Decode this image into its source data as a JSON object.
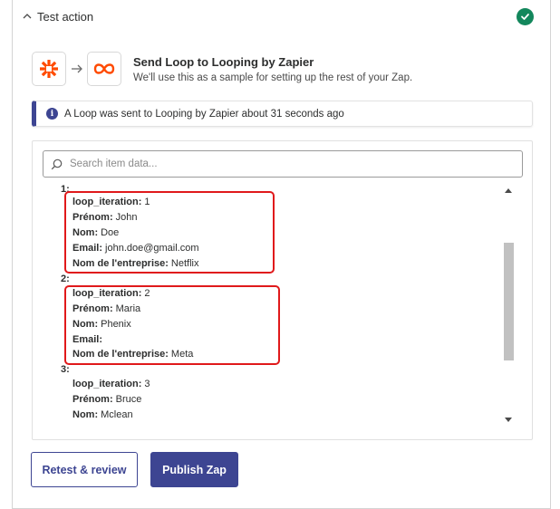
{
  "step": {
    "title": "Test action",
    "status": "success"
  },
  "action": {
    "title": "Send Loop to Looping by Zapier",
    "subtitle": "We'll use this as a sample for setting up the rest of your Zap.",
    "trigger_app_icon": "zapier-asterisk-icon",
    "action_app_icon": "looping-infinity-icon"
  },
  "banner": {
    "icon": "info-icon",
    "icon_glyph": "i",
    "text": "A Loop was sent to Looping by Zapier about 31 seconds ago"
  },
  "search": {
    "placeholder": "Search item data..."
  },
  "items": [
    {
      "index": "1:",
      "fields": [
        {
          "key": "loop_iteration:",
          "value": "1"
        },
        {
          "key": "Prénom:",
          "value": "John"
        },
        {
          "key": "Nom:",
          "value": "Doe"
        },
        {
          "key": "Email:",
          "value": "john.doe@gmail.com"
        },
        {
          "key": "Nom de l'entreprise:",
          "value": "Netflix"
        }
      ]
    },
    {
      "index": "2:",
      "fields": [
        {
          "key": "loop_iteration:",
          "value": "2"
        },
        {
          "key": "Prénom:",
          "value": "Maria"
        },
        {
          "key": "Nom:",
          "value": "Phenix"
        },
        {
          "key": "Email:",
          "value": ""
        },
        {
          "key": "Nom de l'entreprise:",
          "value": "Meta"
        }
      ]
    },
    {
      "index": "3:",
      "fields": [
        {
          "key": "loop_iteration:",
          "value": "3"
        },
        {
          "key": "Prénom:",
          "value": "Bruce"
        },
        {
          "key": "Nom:",
          "value": "Mclean"
        }
      ]
    }
  ],
  "buttons": {
    "retest": "Retest & review",
    "publish": "Publish Zap"
  },
  "colors": {
    "brand": "#3d4592",
    "success": "#13875c",
    "highlight": "#e0191b",
    "zapier_orange": "#ff4a00"
  }
}
